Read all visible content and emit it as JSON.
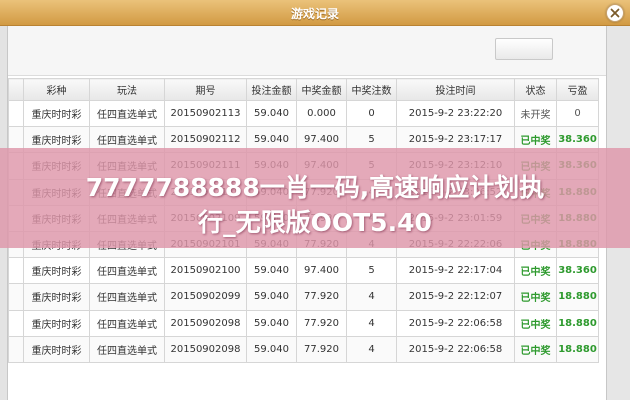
{
  "window": {
    "title": "游戏记录"
  },
  "table": {
    "headers": [
      "彩种",
      "玩法",
      "期号",
      "投注金额",
      "中奖金额",
      "中奖注数",
      "投注时间",
      "状态",
      "亏盈"
    ],
    "rows": [
      [
        "重庆时时彩",
        "任四直选单式",
        "20150902113",
        "59.040",
        "0.000",
        "0",
        "2015-9-2 23:22:20",
        "未开奖",
        "0"
      ],
      [
        "重庆时时彩",
        "任四直选单式",
        "20150902112",
        "59.040",
        "97.400",
        "5",
        "2015-9-2 23:17:17",
        "已中奖",
        "38.360"
      ],
      [
        "重庆时时彩",
        "任四直选单式",
        "20150902111",
        "59.040",
        "97.400",
        "5",
        "2015-9-2 23:12:10",
        "已中奖",
        "38.360"
      ],
      [
        "重庆时时彩",
        "任四直选单式",
        "20150902110",
        "59.040",
        "77.920",
        "4",
        "2015-9-2 23:06:52",
        "已中奖",
        "18.880"
      ],
      [
        "重庆时时彩",
        "任四直选单式",
        "20150902109",
        "59.040",
        "77.920",
        "4",
        "2015-9-2 23:01:59",
        "已中奖",
        "18.880"
      ],
      [
        "重庆时时彩",
        "任四直选单式",
        "20150902101",
        "59.040",
        "77.920",
        "4",
        "2015-9-2 22:22:06",
        "已中奖",
        "18.880"
      ],
      [
        "重庆时时彩",
        "任四直选单式",
        "20150902100",
        "59.040",
        "97.400",
        "5",
        "2015-9-2 22:17:04",
        "已中奖",
        "38.360"
      ],
      [
        "重庆时时彩",
        "任四直选单式",
        "20150902099",
        "59.040",
        "77.920",
        "4",
        "2015-9-2 22:12:07",
        "已中奖",
        "18.880"
      ],
      [
        "重庆时时彩",
        "任四直选单式",
        "20150902098",
        "59.040",
        "77.920",
        "4",
        "2015-9-2 22:06:58",
        "已中奖",
        "18.880"
      ],
      [
        "重庆时时彩",
        "任四直选单式",
        "20150902098",
        "59.040",
        "77.920",
        "4",
        "2015-9-2 22:06:58",
        "已中奖",
        "18.880"
      ]
    ]
  },
  "overlay": {
    "line1": "7777788888一肖一码,高速响应计划执",
    "line2": "行_无限版OOT5.40"
  },
  "colors": {
    "titlebar_accent": "#d29a43",
    "won_green": "#2e9a2e",
    "overlay_pink": "#de96aa"
  },
  "icons": {
    "close": "close-icon"
  }
}
